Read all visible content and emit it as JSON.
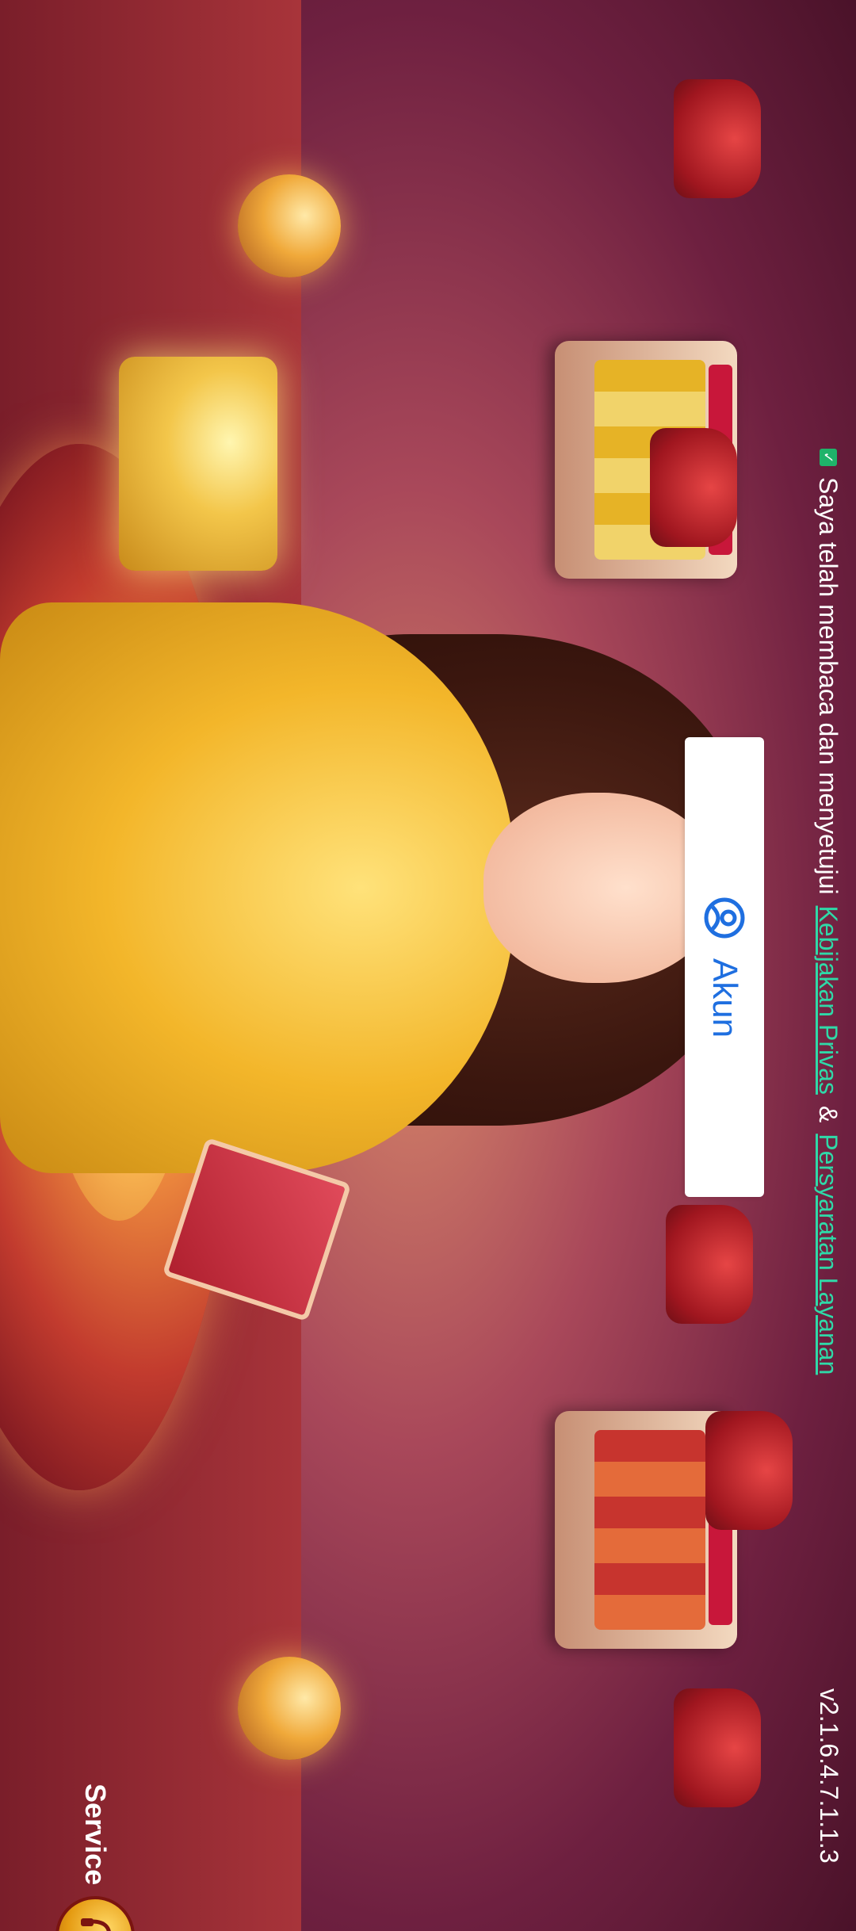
{
  "login": {
    "account_button_label": "Akun"
  },
  "consent": {
    "prefix_text": "Saya telah membaca dan menyetujui",
    "privacy_link": "Kebijakan Privas",
    "joiner": "&",
    "terms_link": "Persyaratan Layanan",
    "checked": true
  },
  "footer": {
    "version": "v2.1.6.4.7.1.1.3"
  },
  "service": {
    "label": "Service",
    "icon": "headset-icon"
  },
  "colors": {
    "account_button_text": "#1f6fe0",
    "link": "#2fd9a8",
    "checkbox": "#1fb36a"
  }
}
